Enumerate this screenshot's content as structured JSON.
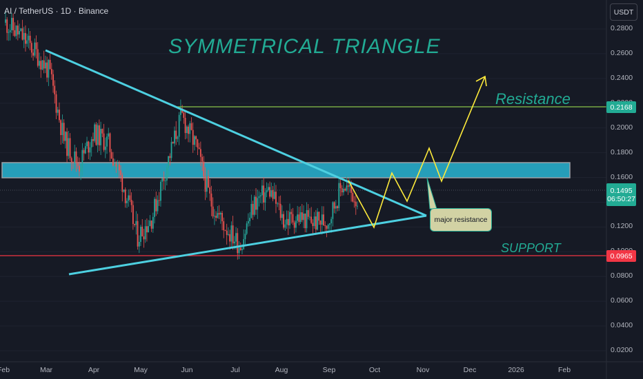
{
  "header": {
    "symbol": "AI / TetherUS · 1D · Binance",
    "currency": "USDT"
  },
  "annotations": {
    "title": "SYMMETRICAL TRIANGLE",
    "resistance_label": "Resistance",
    "support_label": "SUPPORT",
    "callout": "major resistance"
  },
  "price_labels": {
    "resistance": "0.2168",
    "current_price": "0.1495",
    "countdown": "06:50:27",
    "support": "0.0965"
  },
  "colors": {
    "background": "#161a25",
    "up": "#26a69a",
    "down": "#ef5350",
    "triangle": "#4dd0e1",
    "zone": "#29b6d4",
    "projection": "#ffeb3b",
    "resistance_line": "#8bc34a",
    "support_line": "#f23645",
    "annotation_text": "#22ab94"
  },
  "chart_data": {
    "type": "candlestick",
    "timeframe": "1D",
    "y_axis": {
      "ticks": [
        "0.2800",
        "0.2600",
        "0.2400",
        "0.2200",
        "0.2000",
        "0.1800",
        "0.1600",
        "0.1400",
        "0.1200",
        "0.1000",
        "0.0800",
        "0.0600",
        "0.0400",
        "0.0200"
      ],
      "range": [
        0.01,
        0.29
      ]
    },
    "x_axis": {
      "ticks": [
        "Feb",
        "Mar",
        "Apr",
        "May",
        "Jun",
        "Jul",
        "Aug",
        "Sep",
        "Oct",
        "Nov",
        "Dec",
        "2026",
        "Feb"
      ]
    },
    "levels": {
      "resistance": 0.2168,
      "support": 0.0965,
      "current": 0.1495
    },
    "resistance_zone": [
      0.1575,
      0.1705
    ],
    "price_path": [
      [
        "Feb",
        0.285
      ],
      [
        "Feb",
        0.275
      ],
      [
        "Feb",
        0.262
      ],
      [
        "Mar",
        0.245
      ],
      [
        "Mar",
        0.19
      ],
      [
        "Mar",
        0.17
      ],
      [
        "Mar",
        0.196
      ],
      [
        "Mar",
        0.188
      ],
      [
        "Apr",
        0.155
      ],
      [
        "Apr",
        0.112
      ],
      [
        "Apr",
        0.128
      ],
      [
        "May",
        0.17
      ],
      [
        "May",
        0.21
      ],
      [
        "May",
        0.185
      ],
      [
        "Jun",
        0.14
      ],
      [
        "Jun",
        0.12
      ],
      [
        "Jul",
        0.105
      ],
      [
        "Jul",
        0.14
      ],
      [
        "Jul",
        0.15
      ],
      [
        "Aug",
        0.125
      ],
      [
        "Aug",
        0.128
      ],
      [
        "Aug",
        0.124
      ],
      [
        "Sep",
        0.125
      ],
      [
        "Sep",
        0.155
      ],
      [
        "Sep",
        0.142
      ]
    ],
    "projection": [
      0.155,
      0.118,
      0.165,
      0.135,
      0.185,
      0.147,
      0.24
    ]
  }
}
